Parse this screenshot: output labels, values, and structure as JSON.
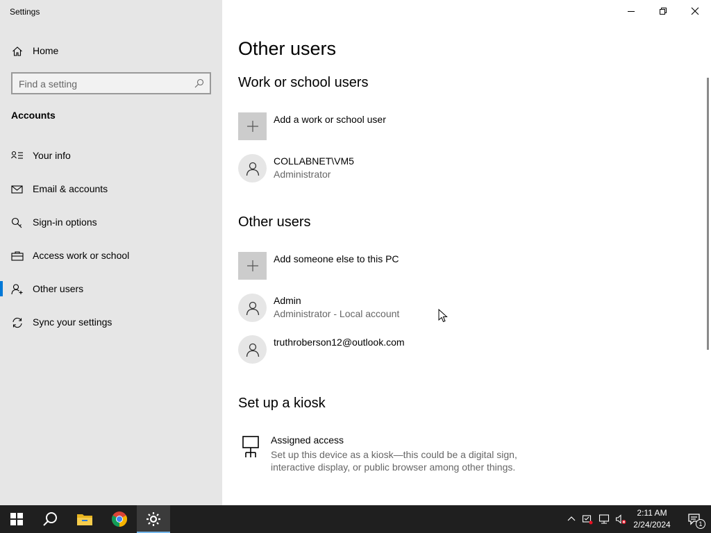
{
  "window": {
    "title": "Settings",
    "controls": {
      "minimize": "minimize",
      "maximize": "restore",
      "close": "close"
    }
  },
  "sidebar": {
    "home_label": "Home",
    "search": {
      "placeholder": "Find a setting"
    },
    "section_header": "Accounts",
    "items": [
      {
        "label": "Your info",
        "icon": "person-card-icon"
      },
      {
        "label": "Email & accounts",
        "icon": "mail-icon"
      },
      {
        "label": "Sign-in options",
        "icon": "key-icon"
      },
      {
        "label": "Access work or school",
        "icon": "briefcase-icon"
      },
      {
        "label": "Other users",
        "icon": "person-add-icon",
        "selected": true
      },
      {
        "label": "Sync your settings",
        "icon": "sync-icon"
      }
    ]
  },
  "main": {
    "title": "Other users",
    "work_section": {
      "heading": "Work or school users",
      "add_label": "Add a work or school user",
      "users": [
        {
          "name": "COLLABNET\\VM5",
          "role": "Administrator"
        }
      ]
    },
    "other_section": {
      "heading": "Other users",
      "add_label": "Add someone else to this PC",
      "users": [
        {
          "name": "Admin",
          "role": "Administrator - Local account"
        },
        {
          "name": "truthroberson12@outlook.com",
          "role": ""
        }
      ]
    },
    "kiosk_section": {
      "heading": "Set up a kiosk",
      "title": "Assigned access",
      "description": "Set up this device as a kiosk—this could be a digital sign, interactive display, or public browser among other things."
    }
  },
  "taskbar": {
    "apps": [
      "start-icon",
      "search-icon",
      "file-explorer-icon",
      "chrome-icon",
      "settings-icon"
    ],
    "active_app": "settings-icon",
    "time": "2:11 AM",
    "date": "2/24/2024",
    "notification_count": "1"
  },
  "colors": {
    "accent": "#0078d7",
    "sidebar_bg": "#e6e6e6",
    "taskbar_bg": "#1f1f1f"
  }
}
